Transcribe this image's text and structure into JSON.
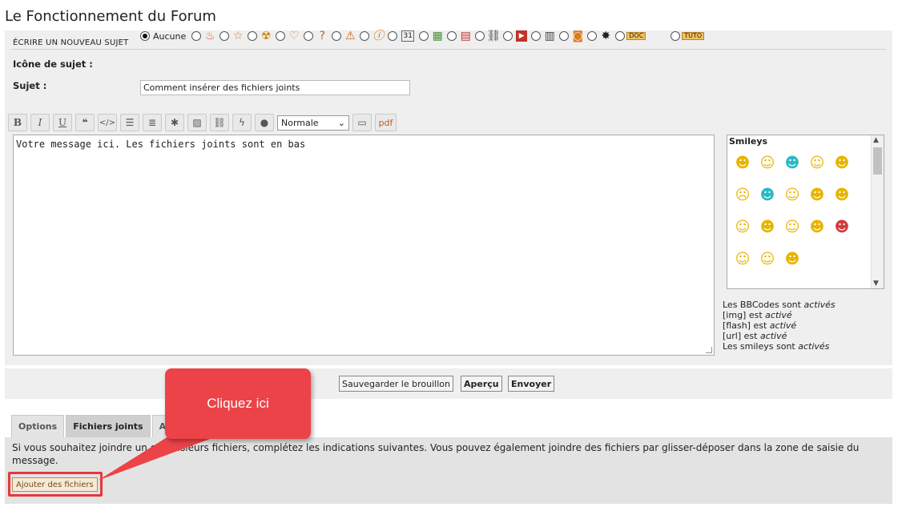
{
  "page_title": "Le Fonctionnement du Forum",
  "form": {
    "header": "ÉCRIRE UN NOUVEAU SUJET",
    "topic_icon_label": "Icône de sujet :",
    "topic_icon_none": "Aucune",
    "topic_icons": [
      "flame-icon",
      "star-icon",
      "radiation-icon",
      "heart-icon",
      "question-icon",
      "warning-icon",
      "info-icon",
      "calendar-icon",
      "map-icon",
      "pdf-file-icon",
      "link-icon",
      "video-icon",
      "chart-icon",
      "camera-icon",
      "percent-icon",
      "doc-folder-icon",
      "tuto-folder-icon"
    ],
    "doc_label": "DOC",
    "tuto_label": "TUTO",
    "subject_label": "Sujet :",
    "subject_value": "Comment insérer des fichiers joints"
  },
  "toolbar": {
    "buttons": [
      "bold-icon",
      "italic-icon",
      "underline-icon",
      "quote-icon",
      "code-icon",
      "bullet-list-icon",
      "numbered-list-icon",
      "asterisk-icon",
      "image-icon",
      "link-icon",
      "flash-icon",
      "color-drop-icon"
    ],
    "size_select": "Normale",
    "pdf_label": "pdf"
  },
  "editor": {
    "content": "Votre message ici. Les fichiers joints sont en bas"
  },
  "smileys": {
    "title": "Smileys"
  },
  "bbcode_info": {
    "l1": "Les BBCodes sont",
    "l1_state": "activés",
    "l2": "[img] est",
    "l2_state": "activé",
    "l3": "[flash] est",
    "l3_state": "activé",
    "l4": "[url] est",
    "l4_state": "activé",
    "l5": "Les smileys sont",
    "l5_state": "activés"
  },
  "actions": {
    "save_draft": "Sauvegarder le brouillon",
    "preview": "Aperçu",
    "send": "Envoyer"
  },
  "tabs": [
    "Options",
    "Fichiers joints",
    "Ajo"
  ],
  "attachments": {
    "description": "Si vous souhaitez joindre un ou plusieurs fichiers, complétez les indications suivantes. Vous pouvez également joindre des fichiers par glisser-déposer dans la zone de saisie du message.",
    "add_button": "Ajouter des fichiers"
  },
  "callout": {
    "text": "Cliquez ici",
    "color": "#ec4348"
  }
}
